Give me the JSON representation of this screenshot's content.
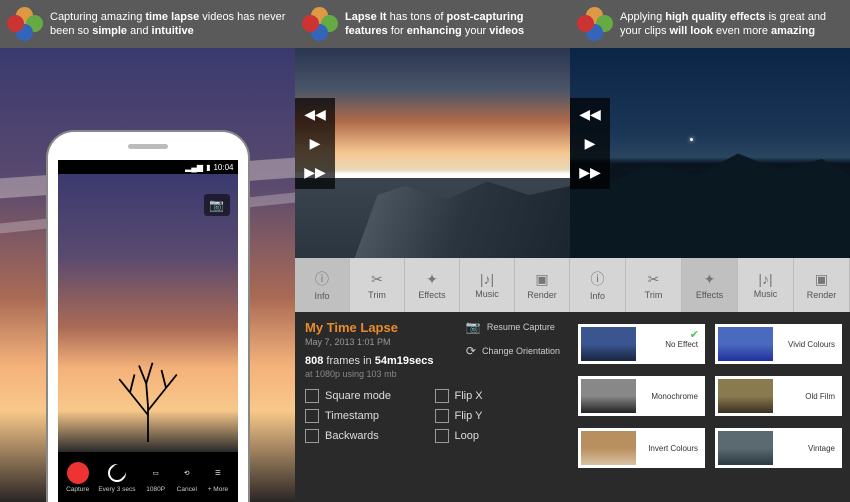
{
  "panel1": {
    "banner_html": "Capturing amazing <b>time lapse</b> videos has never been so <b>simple</b> and <b>intuitive</b>",
    "status_time": "10:04",
    "capture_bar": [
      "Capture",
      "Every 3 secs",
      "1080P",
      "Cancel",
      "+ More"
    ]
  },
  "panel2": {
    "banner_html": "<b>Lapse It</b> has tons of <b>post-capturing features</b> for <b>enhancing</b> your <b>videos</b>",
    "tabs": [
      "Info",
      "Trim",
      "Effects",
      "Music",
      "Render"
    ],
    "active_tab": 0,
    "title": "My Time Lapse",
    "date": "May 7, 2013 1:01 PM",
    "frames": "808",
    "frames_label": "frames in",
    "duration": "54m19secs",
    "encoding": "at 1080p using 103 mb",
    "side_actions": [
      "Resume Capture",
      "Change Orientation"
    ],
    "checkboxes": [
      "Square mode",
      "Flip X",
      "Timestamp",
      "Flip Y",
      "Backwards",
      "Loop"
    ]
  },
  "panel3": {
    "banner_html": "Applying <b>high quality effects</b> is great and your clips <b>will look</b> even more <b>amazing</b>",
    "tabs": [
      "Info",
      "Trim",
      "Effects",
      "Music",
      "Render"
    ],
    "active_tab": 2,
    "effects": [
      {
        "name": "No Effect",
        "selected": true,
        "thumb": "th-normal"
      },
      {
        "name": "Vivid Colours",
        "selected": false,
        "thumb": "th-vivid"
      },
      {
        "name": "Monochrome",
        "selected": false,
        "thumb": "th-mono"
      },
      {
        "name": "Old Film",
        "selected": false,
        "thumb": "th-old"
      },
      {
        "name": "Invert Colours",
        "selected": false,
        "thumb": "th-invert"
      },
      {
        "name": "Vintage",
        "selected": false,
        "thumb": "th-vintage"
      }
    ]
  }
}
